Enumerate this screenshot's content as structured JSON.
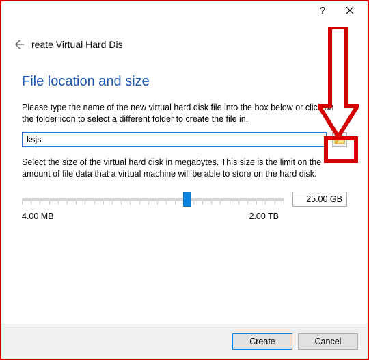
{
  "titlebar": {
    "help": "?",
    "close": ""
  },
  "wizard_title": "reate Virtual Hard Dis",
  "heading": "File location and size",
  "paragraphs": {
    "file_hint": "Please type the name of the new virtual hard disk file into the box below or click on the folder icon to select a different folder to create the file in.",
    "size_hint": "Select the size of the virtual hard disk in megabytes. This size is the limit on the amount of file data that a virtual machine will be able to store on the hard disk."
  },
  "file_input": {
    "value": "ksjs"
  },
  "slider": {
    "min_label": "4.00 MB",
    "max_label": "2.00 TB",
    "value_label": "25.00 GB"
  },
  "buttons": {
    "create": "Create",
    "cancel": "Cancel"
  }
}
